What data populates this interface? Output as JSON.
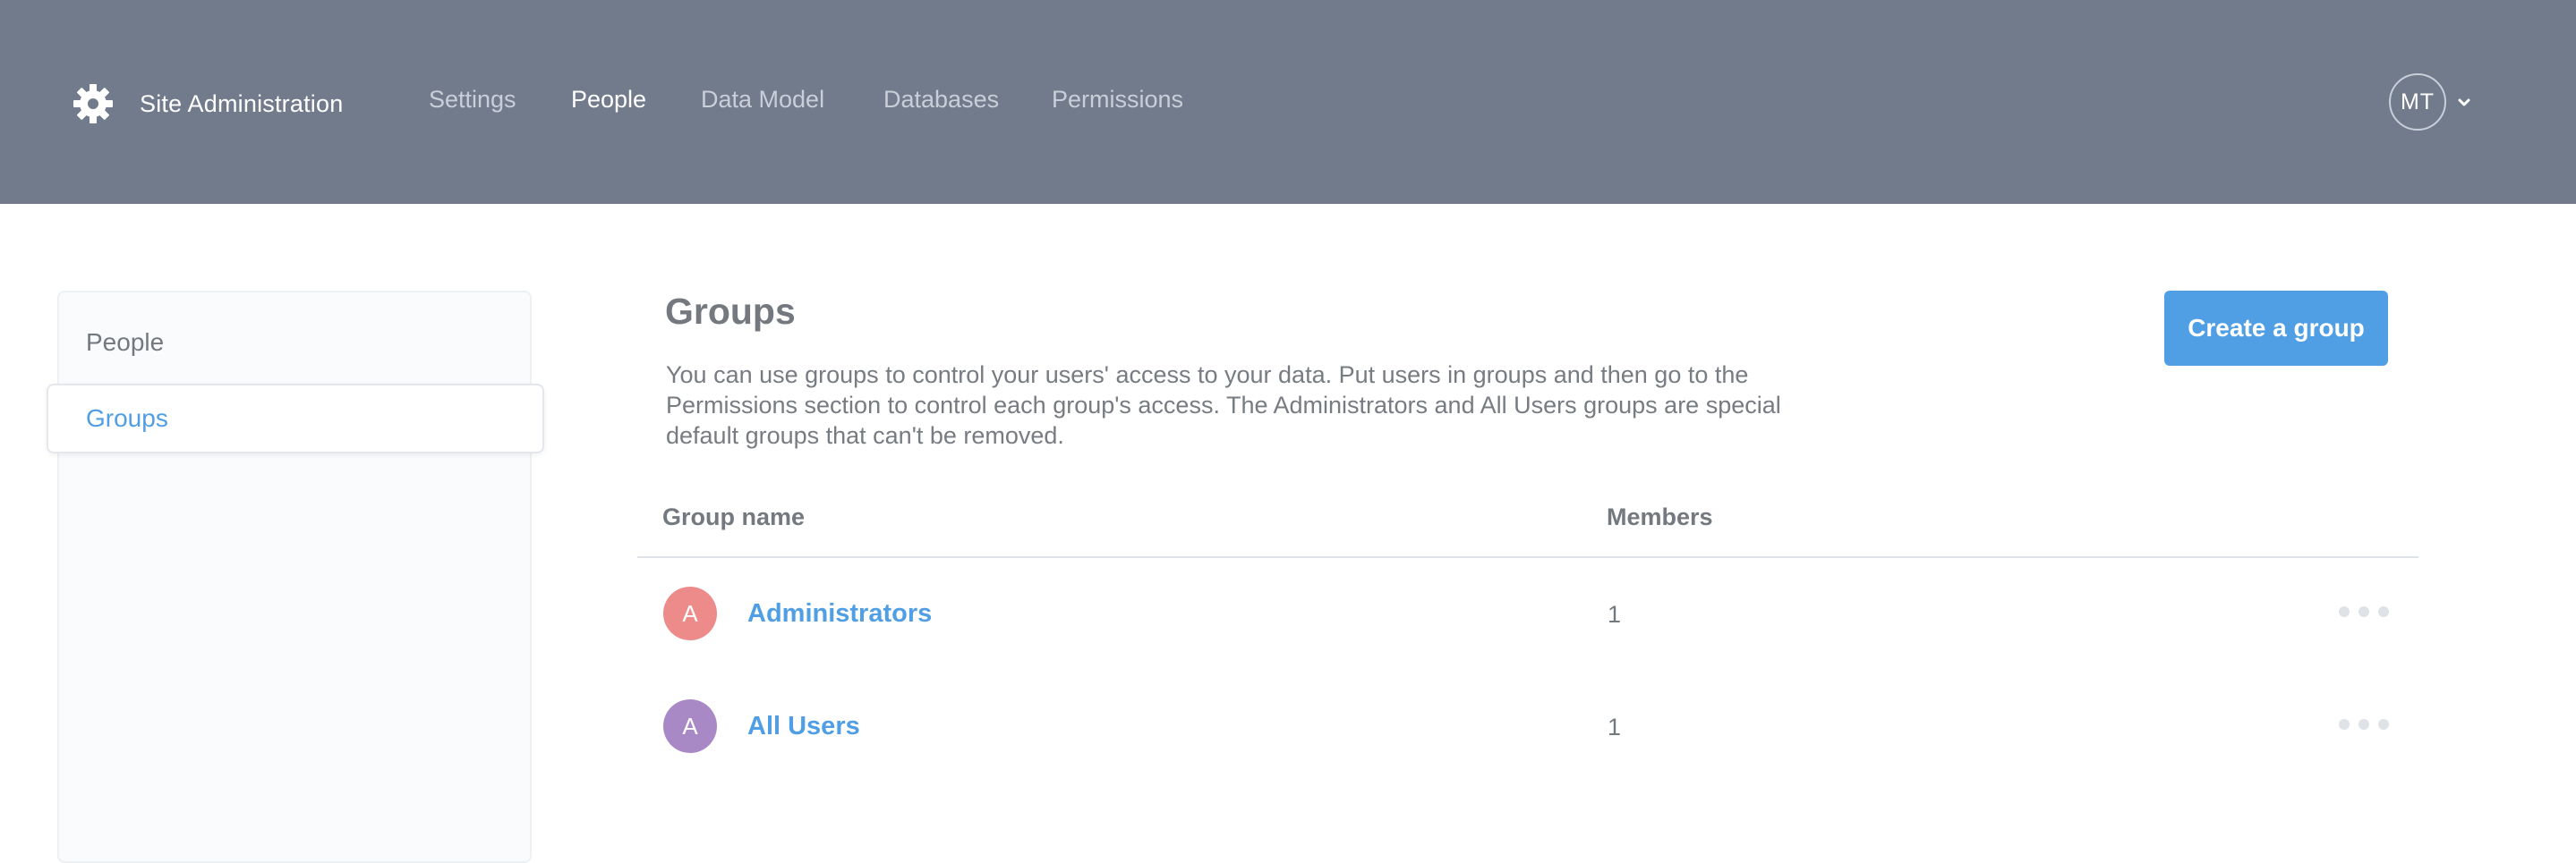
{
  "header": {
    "brand_label": "Site Administration",
    "brand_icon": "gear-icon",
    "nav": [
      {
        "label": "Settings",
        "active": false
      },
      {
        "label": "People",
        "active": true
      },
      {
        "label": "Data Model",
        "active": false
      },
      {
        "label": "Databases",
        "active": false
      },
      {
        "label": "Permissions",
        "active": false
      }
    ],
    "user_initials": "MT"
  },
  "sidebar": {
    "items": [
      {
        "label": "People",
        "selected": false
      },
      {
        "label": "Groups",
        "selected": true
      }
    ]
  },
  "main": {
    "title": "Groups",
    "description": "You can use groups to control your users' access to your data. Put users in groups and then go to the Permissions section to control each group's access. The Administrators and All Users groups are special default groups that can't be removed.",
    "create_button": "Create a group",
    "table": {
      "columns": [
        "Group name",
        "Members"
      ],
      "rows": [
        {
          "initial": "A",
          "name": "Administrators",
          "members": "1",
          "avatar_color": "#ed8a8a"
        },
        {
          "initial": "A",
          "name": "All Users",
          "members": "1",
          "avatar_color": "#a989c5"
        }
      ]
    }
  },
  "colors": {
    "header_bg": "#717b8c",
    "accent": "#509ee3",
    "text_muted": "#74787f"
  }
}
